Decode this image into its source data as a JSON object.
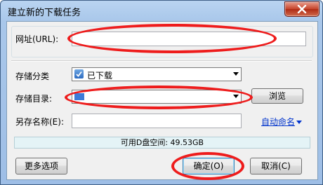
{
  "window": {
    "title": "建立新的下载任务"
  },
  "form": {
    "url_label": "网址(URL):",
    "url_value": "",
    "category_label": "存储分类",
    "category_value": "已下载",
    "directory_label": "存储目录:",
    "directory_value": "",
    "browse_label": "浏览",
    "saveas_label": "另存名称(E):",
    "saveas_value": "",
    "auto_name_label": "自动命名"
  },
  "status": {
    "free_space": "可用D盘空间: 49.53GB"
  },
  "buttons": {
    "more_options": "更多选项",
    "ok": "确定(O)",
    "cancel": "取消(C)"
  },
  "annotations": {
    "color": "#ee1c1c"
  }
}
